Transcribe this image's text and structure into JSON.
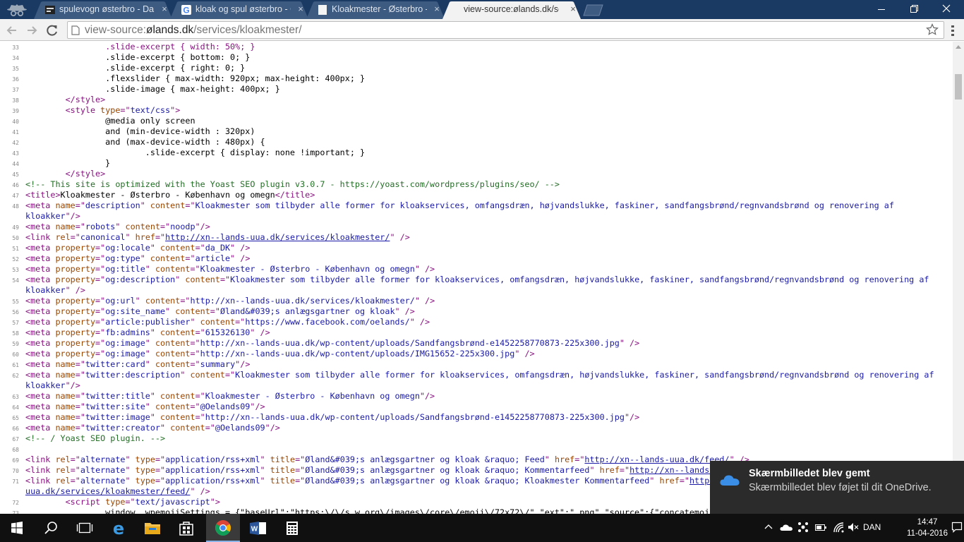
{
  "tabs": [
    {
      "title": "spulevogn østerbro - Dan",
      "close": "×",
      "favicon": "site-favicon-icon"
    },
    {
      "title": "kloak og spul østerbro - G",
      "close": "×",
      "favicon": "google-icon"
    },
    {
      "title": "Kloakmester - Østerbro - K",
      "close": "×",
      "favicon": "blank-page-icon"
    },
    {
      "title": "view-source:ølands.dk/ser",
      "close": "×",
      "favicon": "none",
      "active": true
    }
  ],
  "window_buttons": {
    "minimize": "—",
    "maximize": "❐",
    "close": "✕"
  },
  "toolbar": {
    "url_prefix": "view-source:",
    "url_host": "ølands.dk",
    "url_path": "/services/kloakmester/"
  },
  "source_lines": [
    {
      "n": "33",
      "html": "                <span class=\"tag\">.slide-excerpt { width: 50%; }</span>"
    },
    {
      "n": "34",
      "html": "                .slide-excerpt { bottom: 0; }"
    },
    {
      "n": "35",
      "html": "                .slide-excerpt { right: 0; }"
    },
    {
      "n": "36",
      "html": "                .flexslider { max-width: 920px; max-height: 400px; }"
    },
    {
      "n": "37",
      "html": "                .slide-image { max-height: 400px; }"
    },
    {
      "n": "38",
      "html": "        <span class=\"tag\">&lt;/style&gt;</span>"
    },
    {
      "n": "39",
      "html": "        <span class=\"tag\">&lt;style <span class=\"attr\">type</span>=\"<span class=\"val\">text/css</span>\"&gt;</span>"
    },
    {
      "n": "40",
      "html": "                @media only screen"
    },
    {
      "n": "41",
      "html": "                and (min-device-width : 320px)"
    },
    {
      "n": "42",
      "html": "                and (max-device-width : 480px) {"
    },
    {
      "n": "43",
      "html": "                        .slide-excerpt { display: none !important; }"
    },
    {
      "n": "44",
      "html": "                }"
    },
    {
      "n": "45",
      "html": "        <span class=\"tag\">&lt;/style&gt;</span>"
    },
    {
      "n": "46",
      "html": "<span class=\"cmt\">&lt;!-- This site is optimized with the Yoast SEO plugin v3.0.7 - https://yoast.com/wordpress/plugins/seo/ --&gt;</span>"
    },
    {
      "n": "47",
      "html": "<span class=\"tag\">&lt;title&gt;</span>Kloakmester - Østerbro - København og omegn<span class=\"tag\">&lt;/title&gt;</span>"
    },
    {
      "n": "48",
      "html": "<span class=\"tag\">&lt;meta <span class=\"attr\">name</span>=\"<span class=\"val\">description</span>\" <span class=\"attr\">content</span>=\"<span class=\"val\">Kloakmester som tilbyder alle former for kloakservices, omfangsdræn, højvandslukke, faskiner, sandfangsbrønd/regnvandsbrønd og renovering af</span></span>"
    },
    {
      "n": "",
      "html": "<span class=\"val\">kloakker</span><span class=\"tag\">\"/&gt;</span>"
    },
    {
      "n": "49",
      "html": "<span class=\"tag\">&lt;meta <span class=\"attr\">name</span>=\"<span class=\"val\">robots</span>\" <span class=\"attr\">content</span>=\"<span class=\"val\">noodp</span>\"/&gt;</span>"
    },
    {
      "n": "50",
      "html": "<span class=\"tag\">&lt;link <span class=\"attr\">rel</span>=\"<span class=\"val\">canonical</span>\" <span class=\"attr\">href</span>=\"<span class=\"lnk\">http://xn--lands-uua.dk/services/kloakmester/</span>\" /&gt;</span>"
    },
    {
      "n": "51",
      "html": "<span class=\"tag\">&lt;meta <span class=\"attr\">property</span>=\"<span class=\"val\">og:locale</span>\" <span class=\"attr\">content</span>=\"<span class=\"val\">da_DK</span>\" /&gt;</span>"
    },
    {
      "n": "52",
      "html": "<span class=\"tag\">&lt;meta <span class=\"attr\">property</span>=\"<span class=\"val\">og:type</span>\" <span class=\"attr\">content</span>=\"<span class=\"val\">article</span>\" /&gt;</span>"
    },
    {
      "n": "53",
      "html": "<span class=\"tag\">&lt;meta <span class=\"attr\">property</span>=\"<span class=\"val\">og:title</span>\" <span class=\"attr\">content</span>=\"<span class=\"val\">Kloakmester - Østerbro - København og omegn</span>\" /&gt;</span>"
    },
    {
      "n": "54",
      "html": "<span class=\"tag\">&lt;meta <span class=\"attr\">property</span>=\"<span class=\"val\">og:description</span>\" <span class=\"attr\">content</span>=\"<span class=\"val\">Kloakmester som tilbyder alle former for kloakservices, omfangsdræn, højvandslukke, faskiner, sandfangsbrønd/regnvandsbrønd og renovering af</span></span>"
    },
    {
      "n": "",
      "html": "<span class=\"val\">kloakker</span><span class=\"tag\">\" /&gt;</span>"
    },
    {
      "n": "55",
      "html": "<span class=\"tag\">&lt;meta <span class=\"attr\">property</span>=\"<span class=\"val\">og:url</span>\" <span class=\"attr\">content</span>=\"<span class=\"val\">http://xn--lands-uua.dk/services/kloakmester/</span>\" /&gt;</span>"
    },
    {
      "n": "56",
      "html": "<span class=\"tag\">&lt;meta <span class=\"attr\">property</span>=\"<span class=\"val\">og:site_name</span>\" <span class=\"attr\">content</span>=\"<span class=\"val\">Øland&amp;#039;s anlægsgartner og kloak</span>\" /&gt;</span>"
    },
    {
      "n": "57",
      "html": "<span class=\"tag\">&lt;meta <span class=\"attr\">property</span>=\"<span class=\"val\">article:publisher</span>\" <span class=\"attr\">content</span>=\"<span class=\"val\">https://www.facebook.com/oelands/</span>\" /&gt;</span>"
    },
    {
      "n": "58",
      "html": "<span class=\"tag\">&lt;meta <span class=\"attr\">property</span>=\"<span class=\"val\">fb:admins</span>\" <span class=\"attr\">content</span>=\"<span class=\"val\">615326130</span>\" /&gt;</span>"
    },
    {
      "n": "59",
      "html": "<span class=\"tag\">&lt;meta <span class=\"attr\">property</span>=\"<span class=\"val\">og:image</span>\" <span class=\"attr\">content</span>=\"<span class=\"val\">http://xn--lands-uua.dk/wp-content/uploads/Sandfangsbrønd-e1452258770873-225x300.jpg</span>\" /&gt;</span>"
    },
    {
      "n": "60",
      "html": "<span class=\"tag\">&lt;meta <span class=\"attr\">property</span>=\"<span class=\"val\">og:image</span>\" <span class=\"attr\">content</span>=\"<span class=\"val\">http://xn--lands-uua.dk/wp-content/uploads/IMG15652-225x300.jpg</span>\" /&gt;</span>"
    },
    {
      "n": "61",
      "html": "<span class=\"tag\">&lt;meta <span class=\"attr\">name</span>=\"<span class=\"val\">twitter:card</span>\" <span class=\"attr\">content</span>=\"<span class=\"val\">summary</span>\"/&gt;</span>"
    },
    {
      "n": "62",
      "html": "<span class=\"tag\">&lt;meta <span class=\"attr\">name</span>=\"<span class=\"val\">twitter:description</span>\" <span class=\"attr\">content</span>=\"<span class=\"val\">Kloakmester som tilbyder alle former for kloakservices, omfangsdræn, højvandslukke, faskiner, sandfangsbrønd/regnvandsbrønd og renovering af</span></span>"
    },
    {
      "n": "",
      "html": "<span class=\"val\">kloakker</span><span class=\"tag\">\"/&gt;</span>"
    },
    {
      "n": "63",
      "html": "<span class=\"tag\">&lt;meta <span class=\"attr\">name</span>=\"<span class=\"val\">twitter:title</span>\" <span class=\"attr\">content</span>=\"<span class=\"val\">Kloakmester - Østerbro - København og omegn</span>\"/&gt;</span>"
    },
    {
      "n": "64",
      "html": "<span class=\"tag\">&lt;meta <span class=\"attr\">name</span>=\"<span class=\"val\">twitter:site</span>\" <span class=\"attr\">content</span>=\"<span class=\"val\">@Oelands09</span>\"/&gt;</span>"
    },
    {
      "n": "65",
      "html": "<span class=\"tag\">&lt;meta <span class=\"attr\">name</span>=\"<span class=\"val\">twitter:image</span>\" <span class=\"attr\">content</span>=\"<span class=\"val\">http://xn--lands-uua.dk/wp-content/uploads/Sandfangsbrønd-e1452258770873-225x300.jpg</span>\"/&gt;</span>"
    },
    {
      "n": "66",
      "html": "<span class=\"tag\">&lt;meta <span class=\"attr\">name</span>=\"<span class=\"val\">twitter:creator</span>\" <span class=\"attr\">content</span>=\"<span class=\"val\">@Oelands09</span>\"/&gt;</span>"
    },
    {
      "n": "67",
      "html": "<span class=\"cmt\">&lt;!-- / Yoast SEO plugin. --&gt;</span>"
    },
    {
      "n": "68",
      "html": ""
    },
    {
      "n": "69",
      "html": "<span class=\"tag\">&lt;link <span class=\"attr\">rel</span>=\"<span class=\"val\">alternate</span>\" <span class=\"attr\">type</span>=\"<span class=\"val\">application/rss+xml</span>\" <span class=\"attr\">title</span>=\"<span class=\"val\">Øland&amp;#039;s anlægsgartner og kloak &amp;raquo; Feed</span>\" <span class=\"attr\">href</span>=\"<span class=\"lnk\">http://xn--lands-uua.dk/feed/</span>\" /&gt;</span>"
    },
    {
      "n": "70",
      "html": "<span class=\"tag\">&lt;link <span class=\"attr\">rel</span>=\"<span class=\"val\">alternate</span>\" <span class=\"attr\">type</span>=\"<span class=\"val\">application/rss+xml</span>\" <span class=\"attr\">title</span>=\"<span class=\"val\">Øland&amp;#039;s anlægsgartner og kloak &amp;raquo; Kommentarfeed</span>\" <span class=\"attr\">href</span>=\"<span class=\"lnk\">http://xn--lands-uua.dk/comments/feed/</span>\" /&gt;</span>"
    },
    {
      "n": "71",
      "html": "<span class=\"tag\">&lt;link <span class=\"attr\">rel</span>=\"<span class=\"val\">alternate</span>\" <span class=\"attr\">type</span>=\"<span class=\"val\">application/rss+xml</span>\" <span class=\"attr\">title</span>=\"<span class=\"val\">Øland&amp;#039;s anlægsgartner og kloak &amp;raquo; Kloakmester Kommentarfeed</span>\" <span class=\"attr\">href</span>=\"<span class=\"lnk\">http://xn--lands-</span></span>"
    },
    {
      "n": "",
      "html": "<span class=\"lnk\">uua.dk/services/kloakmester/feed/</span><span class=\"tag\">\" /&gt;</span>"
    },
    {
      "n": "72",
      "html": "        <span class=\"tag\">&lt;script <span class=\"attr\">type</span>=\"<span class=\"val\">text/javascript</span>\"&gt;</span>"
    },
    {
      "n": "73",
      "html": "                window._wpemojiSettings = {\"baseUrl\":\"https:\\/\\/s.w.org\\/images\\/core\\/emoji\\/72x72\\/\",\"ext\":\".png\",\"source\":{\"concatemoji\":\"http:\\/\\/xn--lands-uua.dk\\/wp-"
    }
  ],
  "toast": {
    "title": "Skærmbilledet blev gemt",
    "body": "Skærmbilledet blev føjet til dit OneDrive.",
    "icon": "onedrive-cloud-icon"
  },
  "taskbar": {
    "apps": [
      "windows-start-icon",
      "search-icon",
      "task-view-icon",
      "edge-icon",
      "file-explorer-icon",
      "store-icon",
      "chrome-icon",
      "word-icon",
      "calculator-icon"
    ],
    "language": "DAN",
    "time": "14:47",
    "date": "11-04-2016"
  },
  "colors": {
    "tabstrip": "#1b3a63",
    "tag": "#881280",
    "attr": "#994500",
    "value": "#1a1aa6",
    "comment": "#236e25",
    "toast_bg": "#2b2b2b",
    "taskbar": "#101010"
  }
}
